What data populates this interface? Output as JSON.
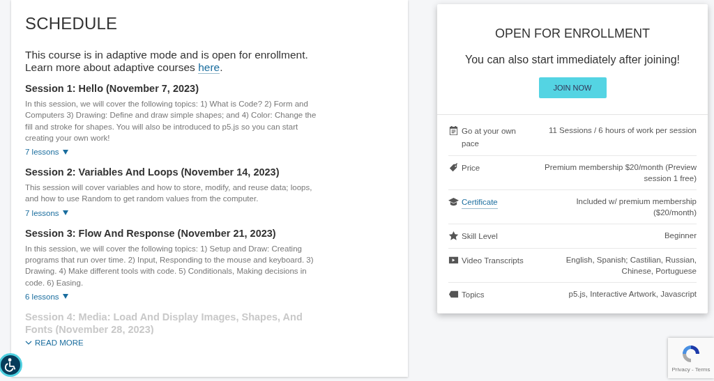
{
  "schedule": {
    "title": "SCHEDULE",
    "intro": {
      "before": "This course is in adaptive mode and is open for enrollment. Learn more about adaptive courses ",
      "link": "here",
      "after": "."
    },
    "sessions": [
      {
        "title": "Session 1: Hello (November 7, 2023)",
        "description": "In this session, we will cover the following topics: 1) What is Code? 2) Form and Computers 3) Drawing: Define and draw simple shapes; and 4) Color: Change the fill and stroke for shapes. You will also be introduced to p5.js so you can start creating your own work!",
        "lessons": "7 lessons",
        "faded": false
      },
      {
        "title": "Session 2: Variables And Loops (November 14, 2023)",
        "description": "This session will cover variables and how to store, modify, and reuse data; loops, and how to use Random to get random values from the computer.",
        "lessons": "7 lessons",
        "faded": false
      },
      {
        "title": "Session 3: Flow And Response (November 21, 2023)",
        "description": "In this session, we will cover the following topics: 1) Setup and Draw: Creating programs that run over time. 2) Input, Responding to the mouse and keyboard. 3) Drawing. 4) Make different tools with code. 5) Conditionals, Making decisions in code. 6) Easing.",
        "lessons": "6 lessons",
        "faded": false
      },
      {
        "title": "Session 4: Media: Load And Display Images, Shapes, And Fonts (November 28, 2023)",
        "faded": true
      }
    ],
    "read_more": "READ MORE"
  },
  "enrollment": {
    "title": "OPEN FOR ENROLLMENT",
    "subtitle": "You can also start immediately after joining!",
    "button": "JOIN NOW",
    "details": [
      {
        "label": "Go at your own pace",
        "value": "11 Sessions / 6 hours of work per session",
        "link": false
      },
      {
        "label": "Price",
        "value": "Premium membership $20/month (Preview session 1 free)",
        "link": false
      },
      {
        "label": "Certificate",
        "value": "Included w/ premium membership ($20/month)",
        "link": true
      },
      {
        "label": "Skill Level",
        "value": "Beginner",
        "link": false
      },
      {
        "label": "Video Transcripts",
        "value": "English, Spanish; Castilian, Russian, Chinese, Portuguese",
        "link": false
      },
      {
        "label": "Topics",
        "value": "p5.js, Interactive Artwork, Javascript",
        "link": false
      }
    ]
  },
  "recaptcha": {
    "links": "Privacy - Terms"
  }
}
